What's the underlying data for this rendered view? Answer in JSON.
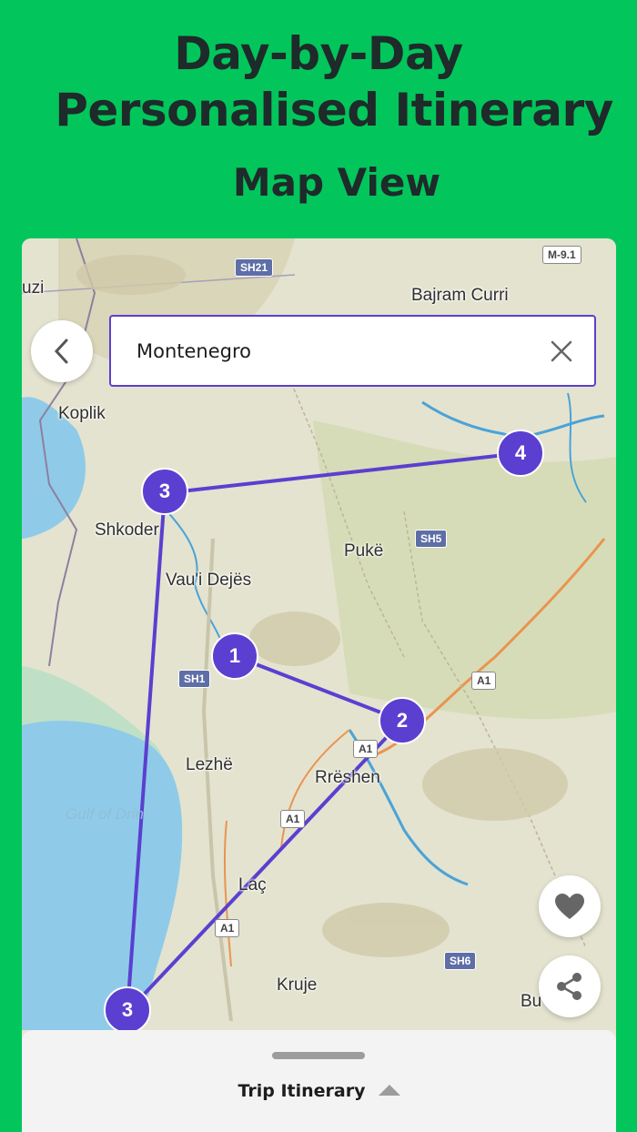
{
  "headline": {
    "line1": "Day-by-Day",
    "line2": "Personalised Itinerary",
    "subtitle": "Map View"
  },
  "search": {
    "value": "Montenegro"
  },
  "map": {
    "places": [
      "uzi",
      "Bajram Curri",
      "Koplik",
      "Shkoder",
      "Pukë",
      "Vau'i Dejës",
      "Lezhë",
      "Rrëshen",
      "Gulf of Drin",
      "Laç",
      "Kruje",
      "Bu"
    ],
    "roads": [
      "SH21",
      "M-9.1",
      "SH5",
      "SH1",
      "A1",
      "A1",
      "A1",
      "A1",
      "SH6"
    ],
    "stops": [
      "1",
      "2",
      "3",
      "3",
      "4"
    ],
    "route_color": "#5b3fd0"
  },
  "actions": {
    "favorite_icon": "heart-icon",
    "share_icon": "share-icon"
  },
  "sheet": {
    "label": "Trip Itinerary"
  },
  "colors": {
    "background": "#02c65b",
    "accent": "#5b3fd0"
  }
}
